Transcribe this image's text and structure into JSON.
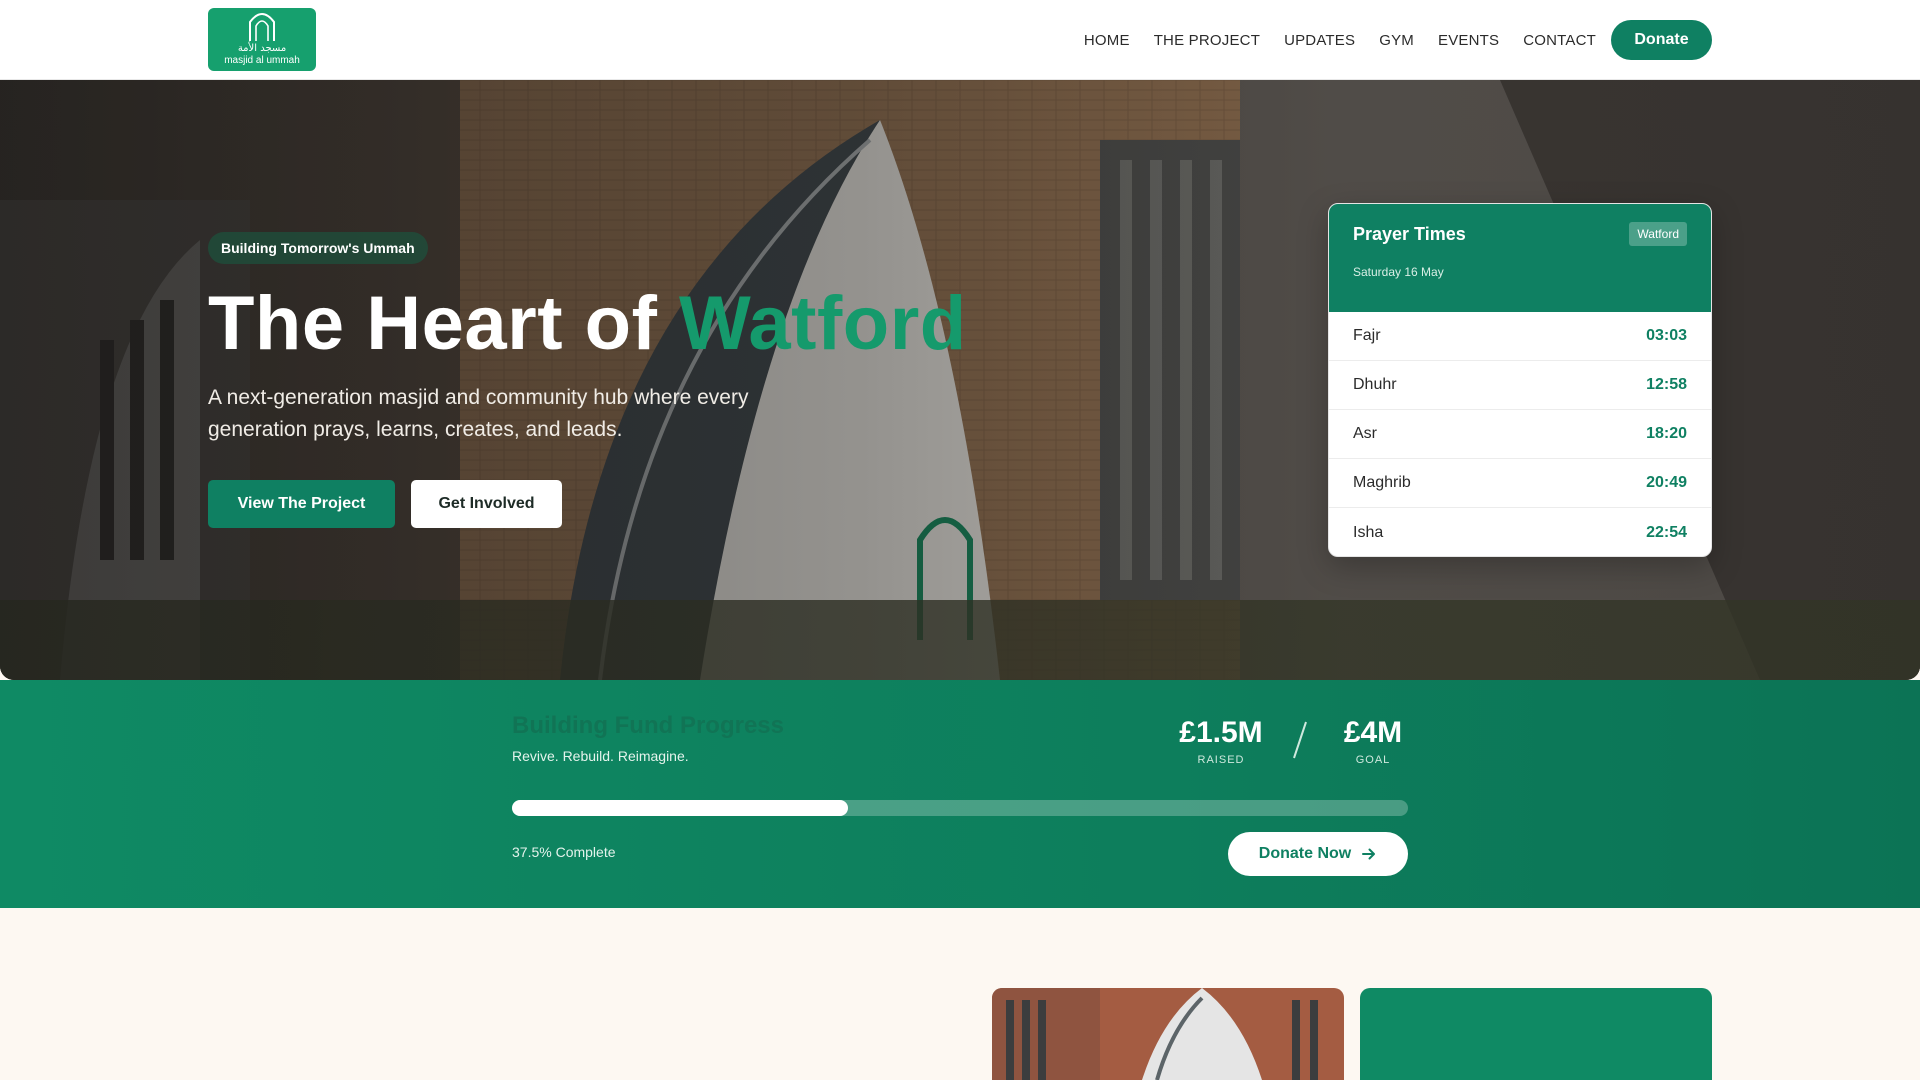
{
  "nav": {
    "logo_arabic": "مسجد الأمة",
    "logo_text": "masjid al ummah",
    "links": [
      "HOME",
      "THE PROJECT",
      "UPDATES",
      "GYM",
      "EVENTS",
      "CONTACT"
    ],
    "donate_label": "Donate"
  },
  "hero": {
    "badge": "Building Tomorrow's Ummah",
    "title_main": "The Heart of ",
    "title_accent": "Watford",
    "subtitle": "A next-generation masjid and community hub where every generation prays, learns, creates, and leads.",
    "primary_button": "View The Project",
    "secondary_button": "Get Involved"
  },
  "prayer_times": {
    "title": "Prayer Times",
    "location": "Watford",
    "date": "Saturday 16 May",
    "rows": [
      {
        "name": "Fajr",
        "time": "03:03"
      },
      {
        "name": "Dhuhr",
        "time": "12:58"
      },
      {
        "name": "Asr",
        "time": "18:20"
      },
      {
        "name": "Maghrib",
        "time": "20:49"
      },
      {
        "name": "Isha",
        "time": "22:54"
      }
    ]
  },
  "fund": {
    "title": "Building Fund Progress",
    "tagline": "Revive. Rebuild. Reimagine.",
    "raised": "£1.5M",
    "raised_label": "RAISED",
    "goal": "£4M",
    "goal_label": "GOAL",
    "progress_fraction": 0.375,
    "progress_text": "37.5% Complete",
    "donate_now_label": "Donate Now"
  },
  "colors": {
    "brand_green": "#0f8062",
    "accent_green": "#159a6c",
    "page_bg": "#fdf8f2"
  }
}
